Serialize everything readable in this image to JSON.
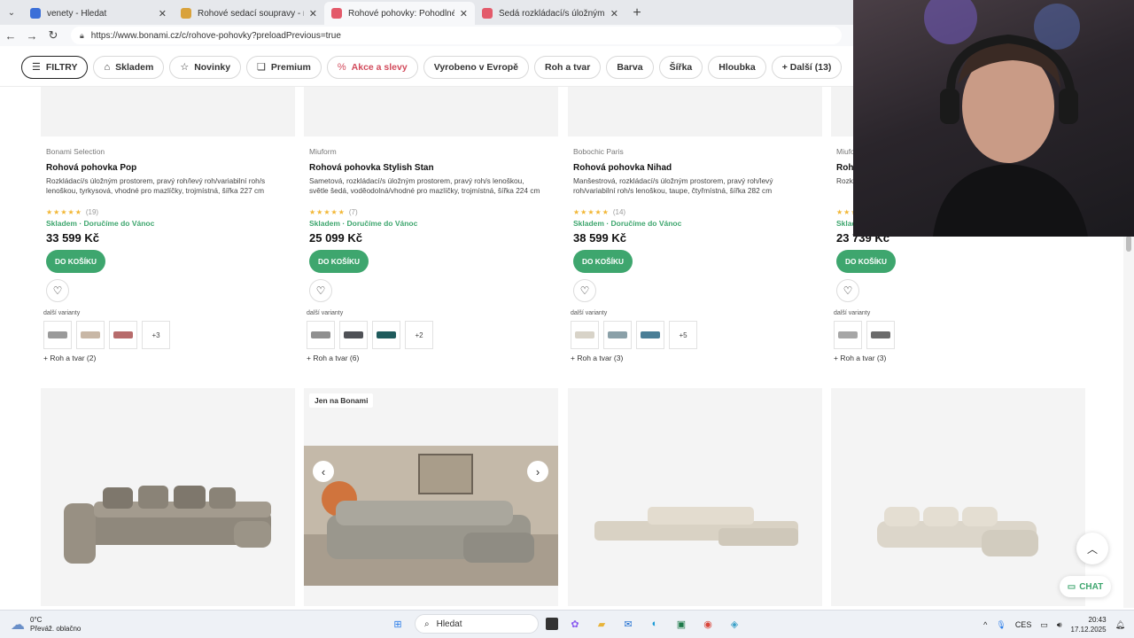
{
  "browser": {
    "tabs": [
      {
        "label": "venety - Hledat",
        "color": "#3b6fd8",
        "active": false
      },
      {
        "label": "Rohové sedací soupravy - malé, ve",
        "color": "#d9a23b",
        "active": false
      },
      {
        "label": "Rohové pohovky: Pohodlné a desi",
        "color": "#e35a6a",
        "active": true
      },
      {
        "label": "Šedá rozkládací/s úložným prostor",
        "color": "#e35a6a",
        "active": false
      }
    ],
    "url": "https://www.bonami.cz/c/rohove-pohovky?preloadPrevious=true"
  },
  "filters": [
    {
      "label": "FILTRY",
      "icon": "sliders-icon",
      "glyph": "☰",
      "name": "filtry"
    },
    {
      "label": "Skladem",
      "icon": "warehouse-icon",
      "glyph": "⌂",
      "name": "skladem"
    },
    {
      "label": "Novinky",
      "icon": "star-icon",
      "glyph": "☆",
      "name": "novinky"
    },
    {
      "label": "Premium",
      "icon": "bookmark-icon",
      "glyph": "❏",
      "name": "premium"
    },
    {
      "label": "Akce a slevy",
      "icon": "percent-icon",
      "glyph": "%",
      "name": "akce"
    },
    {
      "label": "Vyrobeno v Evropě",
      "name": "evropa"
    },
    {
      "label": "Roh a tvar",
      "name": "roh"
    },
    {
      "label": "Barva",
      "name": "barva"
    },
    {
      "label": "Šířka",
      "name": "sirka"
    },
    {
      "label": "Hloubka",
      "name": "hloubka"
    },
    {
      "label": "+ Další (13)",
      "name": "dalsi"
    }
  ],
  "products": [
    {
      "brand": "Bonami Selection",
      "name": "Rohová pohovka Pop",
      "desc": "Rozkládací/s úložným prostorem, pravý roh/levý roh/variabilní roh/s lenoškou, tyrkysová, vhodné pro mazlíčky, trojmístná, šířka 227 cm",
      "reviews": "(19)",
      "stock": "Skladem · Doručíme do Vánoc",
      "price": "33 599 Kč",
      "variant_colors": [
        "#9a9a9a",
        "#c8b7a6",
        "#b76b6b"
      ],
      "more": "+3",
      "roh": "+ Roh a tvar (2)"
    },
    {
      "brand": "Miuform",
      "name": "Rohová pohovka Stylish Stan",
      "desc": "Sametová, rozkládací/s úložným prostorem, pravý roh/s lenoškou, světle šedá, voděodolná/vhodné pro mazlíčky, trojmístná, šířka 224 cm",
      "reviews": "(7)",
      "stock": "Skladem · Doručíme do Vánoc",
      "price": "25 099 Kč",
      "variant_colors": [
        "#8f8f8f",
        "#4f5156",
        "#1f5b5c"
      ],
      "more": "+2",
      "roh": "+ Roh a tvar (6)"
    },
    {
      "brand": "Bobochic Paris",
      "name": "Rohová pohovka Nihad",
      "desc": "Manšestrová, rozkládací/s úložným prostorem, pravý roh/levý roh/variabilní roh/s lenoškou, taupe, čtyřmístná, šířka 282 cm",
      "reviews": "(14)",
      "stock": "Skladem · Doručíme do Vánoc",
      "price": "38 599 Kč",
      "variant_colors": [
        "#d8d3c8",
        "#8aa0a8",
        "#4a7e96"
      ],
      "more": "+5",
      "roh": "+ Roh a tvar (3)"
    },
    {
      "brand": "Miuform",
      "name": "Rohová pohovka",
      "desc": "Rozkládací/s úložným prostorem, šedá, čtyřmístná",
      "reviews": "",
      "stock": "Skladem",
      "price": "23 739 Kč",
      "variant_colors": [
        "#a6a6a6",
        "#6b6b6b"
      ],
      "more": "",
      "roh": "+ Roh a tvar (3)"
    }
  ],
  "labels": {
    "cart": "DO KOŠÍKU",
    "variants": "další varianty",
    "tag_bonami": "Jen na Bonami",
    "chat": "CHAT",
    "prev": "‹",
    "next": "›"
  },
  "taskbar": {
    "temp": "0°C",
    "weather": "Převáž. oblačno",
    "search": "Hledat",
    "lang": "CES",
    "time": "20:43",
    "date": "17.12.2025"
  }
}
